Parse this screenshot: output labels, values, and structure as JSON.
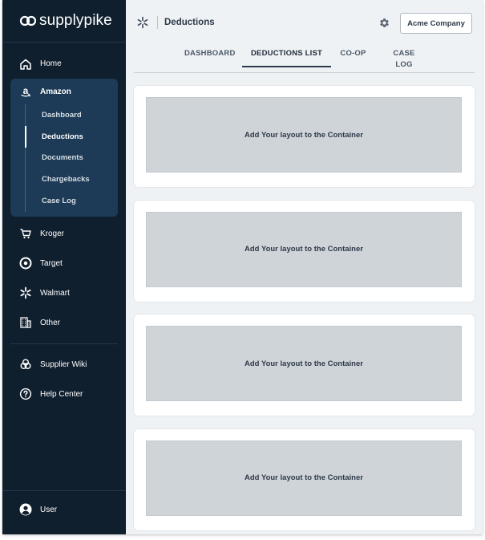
{
  "brand": {
    "name": "supplypike"
  },
  "sidebar": {
    "home": "Home",
    "amazon": {
      "label": "Amazon",
      "items": [
        "Dashboard",
        "Deductions",
        "Documents",
        "Chargebacks",
        "Case Log"
      ],
      "active_index": 1
    },
    "retailers": [
      {
        "label": "Kroger",
        "icon": "kroger-cart-icon"
      },
      {
        "label": "Target",
        "icon": "target-icon"
      },
      {
        "label": "Walmart",
        "icon": "walmart-spark-icon"
      },
      {
        "label": "Other",
        "icon": "building-icon"
      }
    ],
    "resources": [
      {
        "label": "Supplier Wiki",
        "icon": "wiki-icon"
      },
      {
        "label": "Help Center",
        "icon": "help-circle-icon"
      }
    ],
    "user": "User"
  },
  "header": {
    "title": "Deductions",
    "company_button": "Acme Company"
  },
  "tabs": [
    "DASHBOARD",
    "DEDUCTIONS LIST",
    "CO-OP",
    "CASE LOG"
  ],
  "active_tab": "DEDUCTIONS LIST",
  "containers": [
    "Add Your layout to the Container",
    "Add Your layout to the Container",
    "Add Your layout to the Container",
    "Add Your layout to the Container"
  ],
  "colors": {
    "sidebar_bg": "#101f2e",
    "group_bg": "#1d3b56",
    "main_bg": "#eff2f5",
    "placeholder_bg": "#cfd4d9"
  }
}
